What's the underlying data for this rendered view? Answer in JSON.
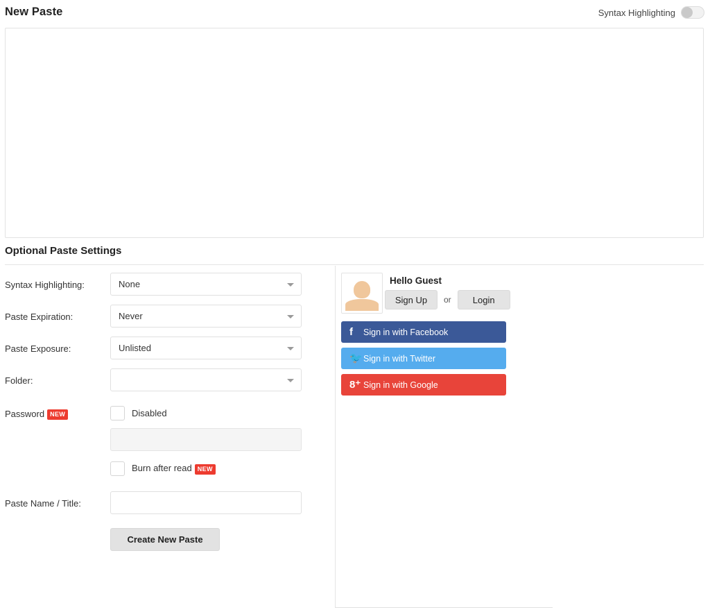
{
  "header": {
    "title": "New Paste",
    "syntax_highlighting_label": "Syntax Highlighting",
    "syntax_highlighting_state": "off"
  },
  "editor": {
    "value": "",
    "placeholder": ""
  },
  "settings": {
    "heading": "Optional Paste Settings",
    "fields": {
      "syntax_highlighting": {
        "label": "Syntax Highlighting:",
        "value": "None"
      },
      "paste_expiration": {
        "label": "Paste Expiration:",
        "value": "Never"
      },
      "paste_exposure": {
        "label": "Paste Exposure:",
        "value": "Unlisted"
      },
      "folder": {
        "label": "Folder:",
        "value": ""
      },
      "password": {
        "label": "Password",
        "badge": "NEW",
        "checkbox_label": "Disabled",
        "checkbox_checked": false,
        "input_value": "",
        "input_placeholder": "",
        "input_disabled": true
      },
      "burn_after_read": {
        "label": "Burn after read",
        "badge": "NEW",
        "checked": false
      },
      "paste_name": {
        "label": "Paste Name / Title:",
        "value": "",
        "placeholder": ""
      }
    },
    "submit_label": "Create New Paste"
  },
  "user_panel": {
    "greeting": "Hello Guest",
    "avatar_alt": "default-avatar",
    "signup_label": "Sign Up",
    "or_label": "or",
    "login_label": "Login",
    "social_buttons": [
      {
        "id": "facebook",
        "label": "Sign in with Facebook",
        "icon": "f",
        "color": "#3b5998"
      },
      {
        "id": "twitter",
        "label": "Sign in with Twitter",
        "icon": "🐦",
        "color": "#55acee"
      },
      {
        "id": "google",
        "label": "Sign in with Google",
        "icon": "8⁺",
        "color": "#e8443a"
      }
    ]
  }
}
